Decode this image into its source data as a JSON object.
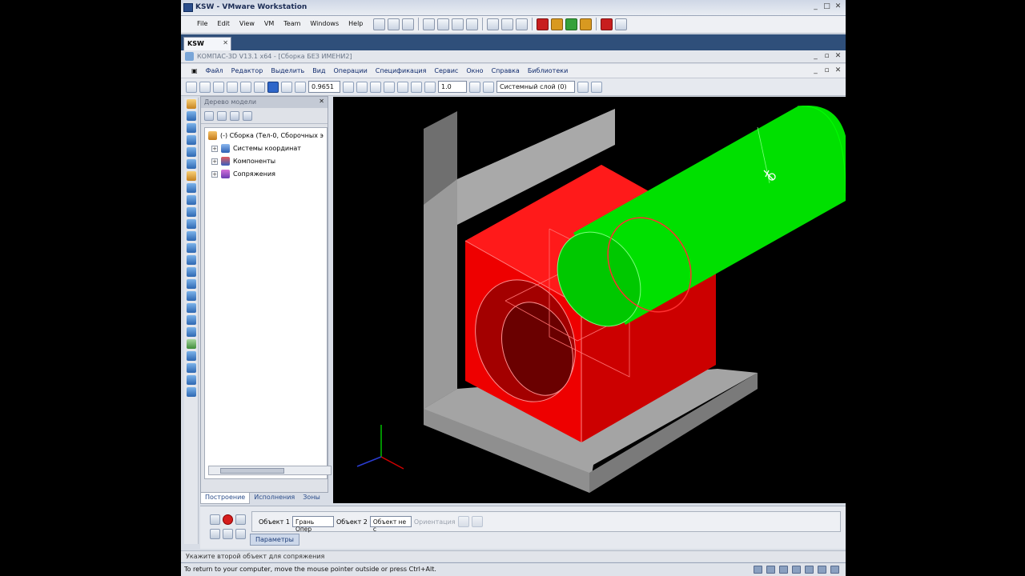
{
  "vm": {
    "title": "KSW - VMware Workstation",
    "menu": [
      "File",
      "Edit",
      "View",
      "VM",
      "Team",
      "Windows",
      "Help"
    ],
    "tab_label": "KSW",
    "status": "To return to your computer, move the mouse pointer outside or press Ctrl+Alt."
  },
  "kompas": {
    "title": "КОМПАС-3D V13.1 x64 - [Сборка БЕЗ ИМЕНИ2]",
    "menu": [
      "Файл",
      "Редактор",
      "Выделить",
      "Вид",
      "Операции",
      "Спецификация",
      "Сервис",
      "Окно",
      "Справка",
      "Библиотеки"
    ],
    "zoom_value": "0.9651",
    "step_value": "1.0",
    "layer_value": "Системный слой (0)",
    "status_hint": "Укажите второй объект для сопряжения"
  },
  "tree": {
    "header": "Дерево модели",
    "root": "(-) Сборка (Тел-0, Сборочных э",
    "nodes": [
      "Системы координат",
      "Компоненты",
      "Сопряжения"
    ],
    "tabs": [
      "Построение",
      "Исполнения",
      "Зоны"
    ]
  },
  "props": {
    "obj1_label": "Объект 1",
    "obj1_value": "Грань Опер",
    "obj2_label": "Объект 2",
    "obj2_value": "Объект не с",
    "orient_label": "Ориентация",
    "tab": "Параметры"
  },
  "colors": {
    "block": "#ff0000",
    "shaft": "#00e600",
    "bracket": "#9a9a9a",
    "viewport_bg": "#000000"
  }
}
